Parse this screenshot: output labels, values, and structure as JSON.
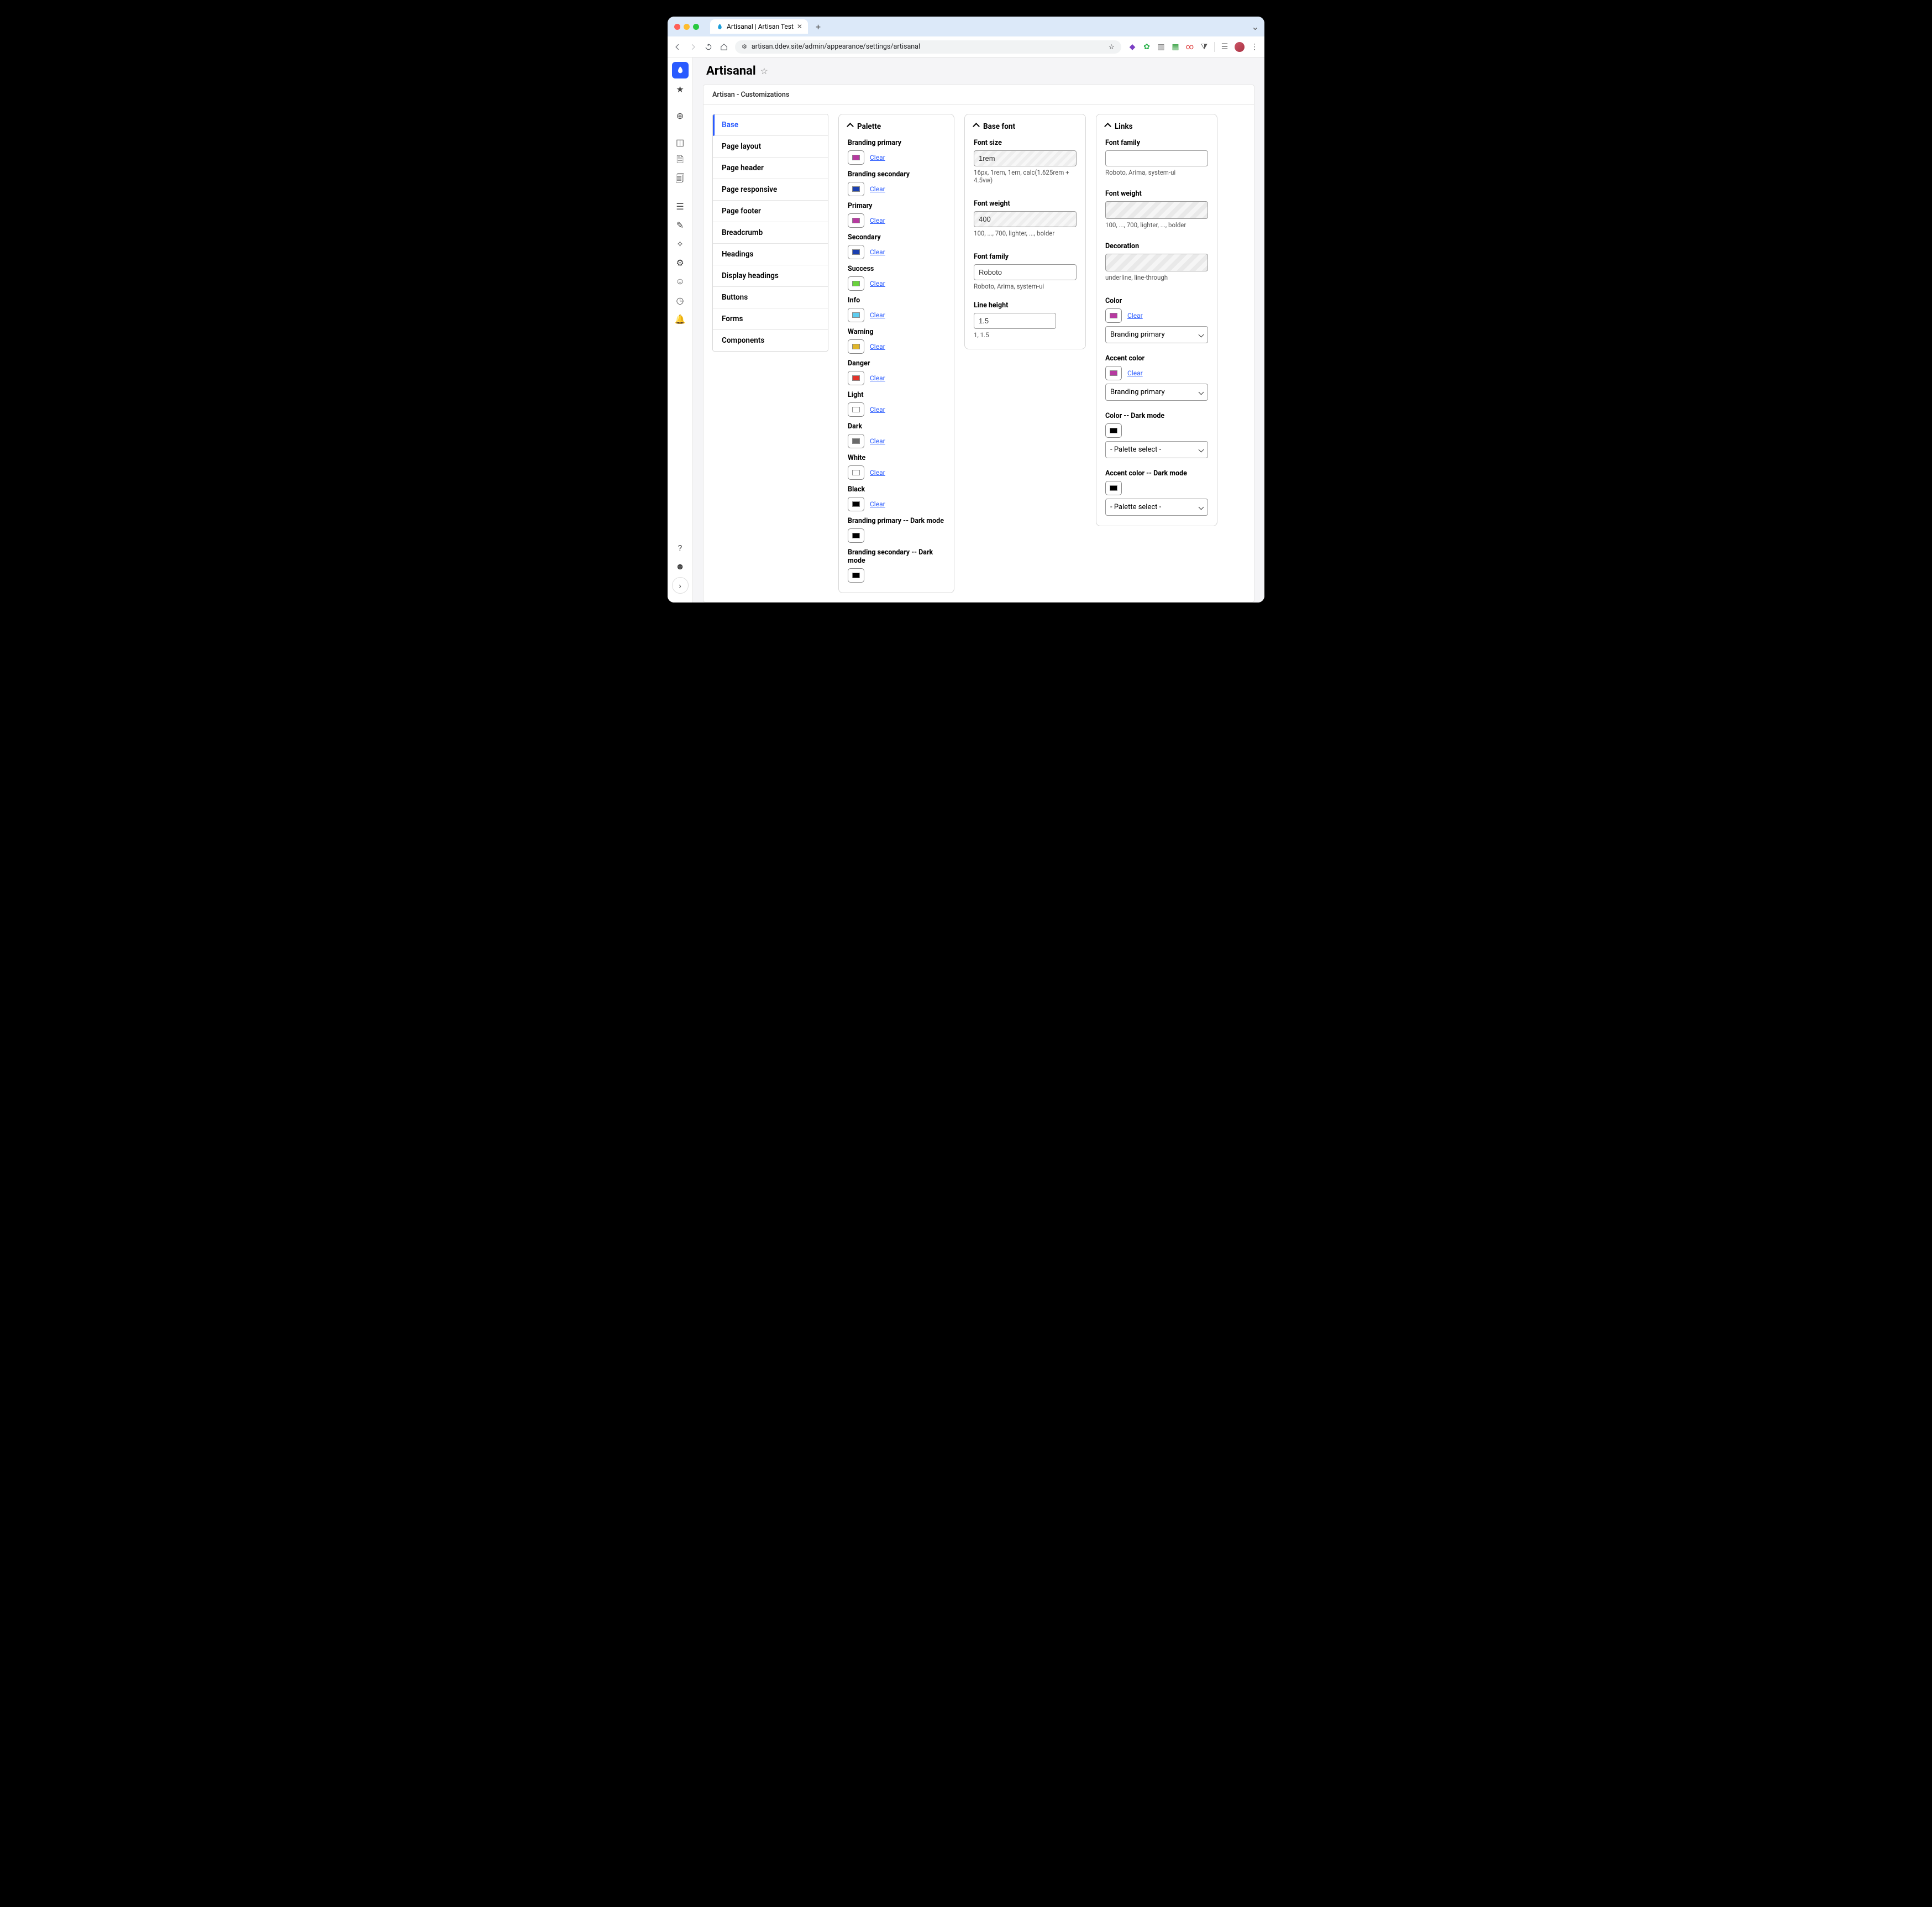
{
  "browser": {
    "tab_title": "Artisanal | Artisan Test",
    "url": "artisan.ddev.site/admin/appearance/settings/artisanal"
  },
  "page": {
    "title": "Artisanal",
    "subtitle": "Artisan - Customizations"
  },
  "vtabs": [
    "Base",
    "Page layout",
    "Page header",
    "Page responsive",
    "Page footer",
    "Breadcrumb",
    "Headings",
    "Display headings",
    "Buttons",
    "Forms",
    "Components"
  ],
  "palette": {
    "heading": "Palette",
    "clear": "Clear",
    "items": [
      {
        "label": "Branding primary",
        "color": "#b63aa0"
      },
      {
        "label": "Branding secondary",
        "color": "#1a3fb0"
      },
      {
        "label": "Primary",
        "color": "#b63aa0"
      },
      {
        "label": "Secondary",
        "color": "#1a3fb0"
      },
      {
        "label": "Success",
        "color": "#6ad23d"
      },
      {
        "label": "Info",
        "color": "#5dcdf0"
      },
      {
        "label": "Warning",
        "color": "#e0b62a"
      },
      {
        "label": "Danger",
        "color": "#e2332a"
      },
      {
        "label": "Light",
        "color": "#ffffff"
      },
      {
        "label": "Dark",
        "color": "#6b6b6b"
      },
      {
        "label": "White",
        "color": "#ffffff"
      },
      {
        "label": "Black",
        "color": "#000000"
      },
      {
        "label": "Branding primary -- Dark mode",
        "color": "#000000"
      },
      {
        "label": "Branding secondary -- Dark mode",
        "color": "#000000"
      }
    ]
  },
  "basefont": {
    "heading": "Base font",
    "font_size_label": "Font size",
    "font_size_value": "1rem",
    "font_size_help": "16px, 1rem, 1em, calc(1.625rem + 4.5vw)",
    "font_weight_label": "Font weight",
    "font_weight_value": "400",
    "font_weight_help": "100, ..., 700, lighter, ..., bolder",
    "font_family_label": "Font family",
    "font_family_value": "Roboto",
    "font_family_help": "Roboto, Arima, system-ui",
    "line_height_label": "Line height",
    "line_height_value": "1.5",
    "line_height_help": "1, 1.5"
  },
  "links": {
    "heading": "Links",
    "font_family_label": "Font family",
    "font_family_value": "",
    "font_family_help": "Roboto, Arima, system-ui",
    "font_weight_label": "Font weight",
    "font_weight_help": "100, ..., 700, lighter, ..., bolder",
    "decoration_label": "Decoration",
    "decoration_help": "underline, line-through",
    "color_label": "Color",
    "color_swatch": "#b63aa0",
    "color_select": "Branding primary",
    "accent_label": "Accent color",
    "accent_swatch": "#b63aa0",
    "accent_select": "Branding primary",
    "color_dark_label": "Color -- Dark mode",
    "color_dark_swatch": "#000000",
    "color_dark_select": "- Palette select -",
    "accent_dark_label": "Accent color -- Dark mode",
    "accent_dark_swatch": "#000000",
    "accent_dark_select": "- Palette select -",
    "clear": "Clear"
  }
}
